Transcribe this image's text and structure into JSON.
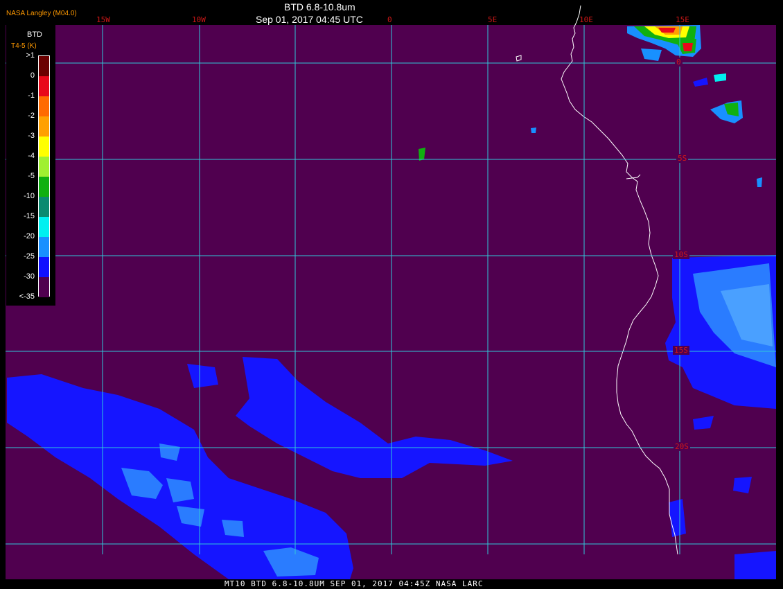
{
  "header": {
    "credit": "NASA Langley (M04.0)",
    "title": "BTD 6.8-10.8um",
    "datetime": "Sep 01, 2017 04:45 UTC"
  },
  "footer": {
    "caption": "MT10  BTD 6.8-10.8UM   SEP 01, 2017 04:45Z   NASA LARC"
  },
  "longitude_labels": [
    "15W",
    "10W",
    "0",
    "5E",
    "10E",
    "15E"
  ],
  "latitude_labels": [
    "0",
    "5S",
    "10S",
    "15S",
    "20S"
  ],
  "legend": {
    "title": "BTD",
    "units": "T4-5 (K)",
    "ticks": [
      ">1",
      "0",
      "-1",
      "-2",
      "-3",
      "-4",
      "-5",
      "-10",
      "-15",
      "-20",
      "-25",
      "-30",
      "<-35"
    ],
    "colors": [
      "#6b0000",
      "#e8081a",
      "#ff6a00",
      "#ffa000",
      "#ffff00",
      "#a0f030",
      "#10b010",
      "#0a8a70",
      "#00f0f0",
      "#1890ff",
      "#1010ff",
      "#50004f"
    ]
  },
  "colors": {
    "background": "#50004f",
    "grid": "#30c8d8",
    "coast": "#ffffff",
    "label_red": "#d01818"
  }
}
